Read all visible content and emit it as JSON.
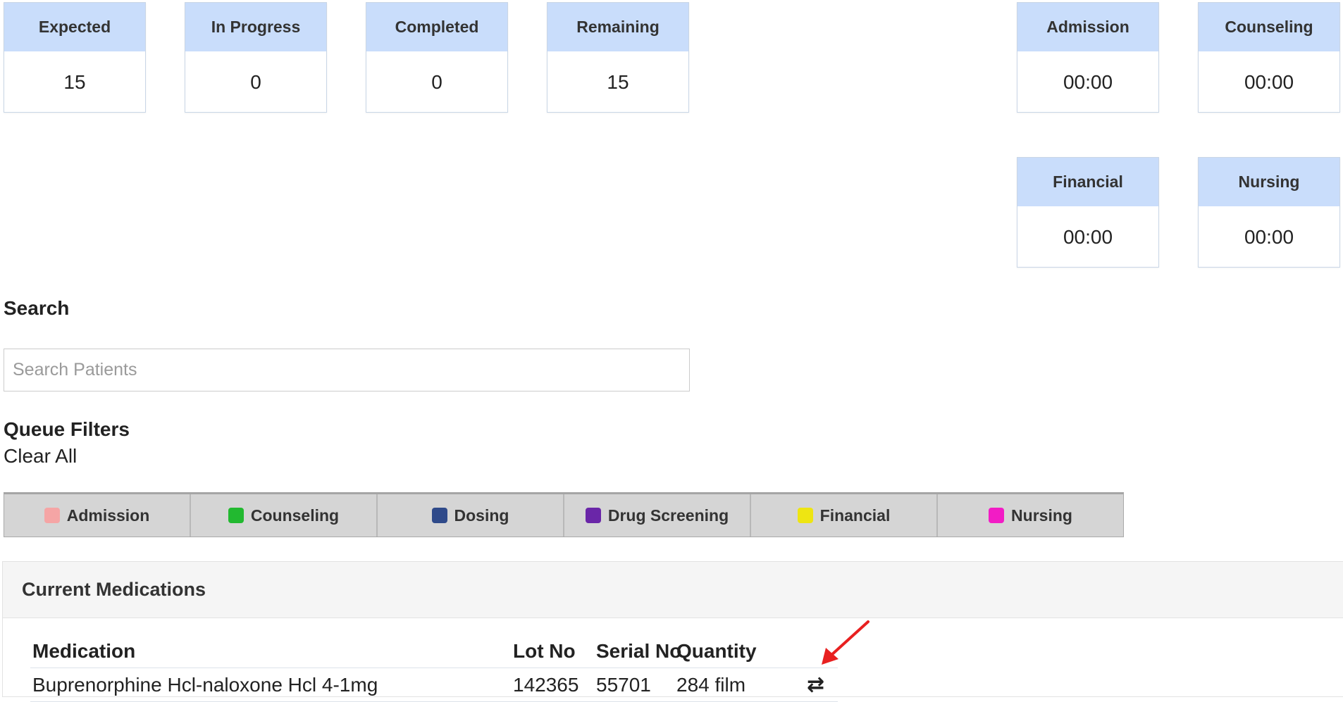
{
  "stats": [
    {
      "label": "Expected",
      "value": "15"
    },
    {
      "label": "In Progress",
      "value": "0"
    },
    {
      "label": "Completed",
      "value": "0"
    },
    {
      "label": "Remaining",
      "value": "15"
    }
  ],
  "timers": [
    {
      "label": "Admission",
      "value": "00:00"
    },
    {
      "label": "Counseling",
      "value": "00:00"
    },
    {
      "label": "Financial",
      "value": "00:00"
    },
    {
      "label": "Nursing",
      "value": "00:00"
    }
  ],
  "search": {
    "title": "Search",
    "placeholder": "Search Patients"
  },
  "filters": {
    "title": "Queue Filters",
    "clear_label": "Clear All",
    "items": [
      {
        "label": "Admission",
        "color": "#f5a5a5"
      },
      {
        "label": "Counseling",
        "color": "#22b930"
      },
      {
        "label": "Dosing",
        "color": "#2f4a8a"
      },
      {
        "label": "Drug Screening",
        "color": "#6a26a8"
      },
      {
        "label": "Financial",
        "color": "#eee512"
      },
      {
        "label": "Nursing",
        "color": "#f21cc5"
      }
    ]
  },
  "medications": {
    "title": "Current Medications",
    "columns": [
      "Medication",
      "Lot No",
      "Serial No",
      "Quantity"
    ],
    "rows": [
      {
        "medication": "Buprenorphine Hcl-naloxone Hcl 4-1mg",
        "lot": "142365",
        "serial": "55701",
        "quantity": "284 film",
        "action_icon": "⇄"
      }
    ]
  },
  "annotation_color": "#e82020"
}
